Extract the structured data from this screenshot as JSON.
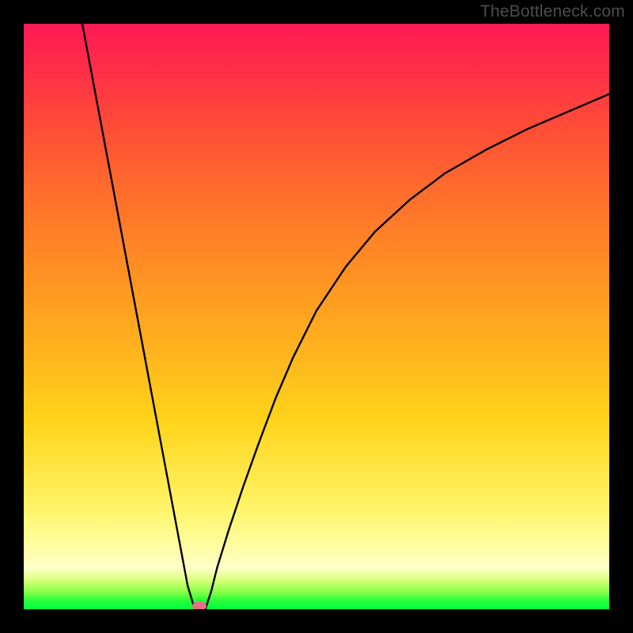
{
  "watermark": "TheBottleneck.com",
  "chart_data": {
    "type": "line",
    "title": "",
    "xlabel": "",
    "ylabel": "",
    "xlim": [
      0,
      100
    ],
    "ylim": [
      0,
      100
    ],
    "grid": false,
    "legend": false,
    "series": [
      {
        "name": "left-branch",
        "x": [
          10,
          11.5,
          13,
          14.5,
          16,
          17.5,
          19,
          20.5,
          22,
          23.5,
          25,
          26.5,
          28,
          29.2
        ],
        "y": [
          100,
          92,
          84,
          76,
          68,
          60,
          52,
          44,
          36,
          28,
          20,
          12,
          4,
          0
        ]
      },
      {
        "name": "right-branch",
        "x": [
          31,
          32,
          33,
          35,
          37.5,
          40,
          43,
          46,
          50,
          55,
          60,
          66,
          72,
          79,
          86,
          93,
          100
        ],
        "y": [
          0,
          3,
          7,
          13.5,
          21,
          28,
          36,
          43,
          51,
          58.5,
          64.5,
          70,
          74.5,
          78.5,
          82,
          85,
          88
        ]
      }
    ],
    "marker": {
      "x": 30,
      "y": 0,
      "color": "#e76f83",
      "radius_px": 7
    }
  },
  "colors": {
    "curve": "#000000",
    "marker": "#e76f83",
    "background_frame": "#000000"
  }
}
